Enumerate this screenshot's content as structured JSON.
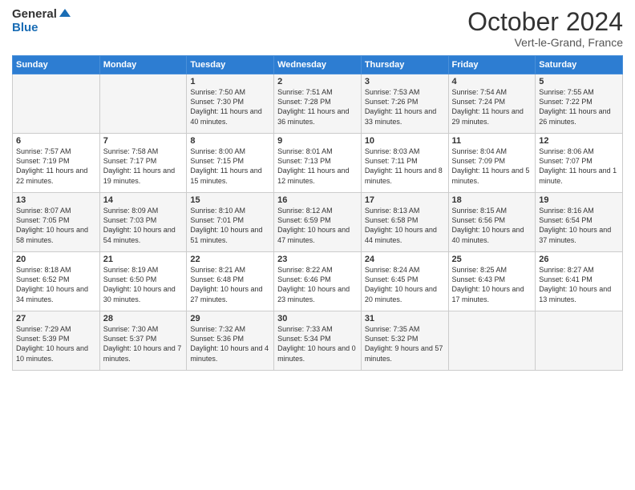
{
  "header": {
    "logo_line1": "General",
    "logo_line2": "Blue",
    "month_title": "October 2024",
    "subtitle": "Vert-le-Grand, France"
  },
  "weekdays": [
    "Sunday",
    "Monday",
    "Tuesday",
    "Wednesday",
    "Thursday",
    "Friday",
    "Saturday"
  ],
  "weeks": [
    [
      {
        "day": "",
        "sunrise": "",
        "sunset": "",
        "daylight": ""
      },
      {
        "day": "",
        "sunrise": "",
        "sunset": "",
        "daylight": ""
      },
      {
        "day": "1",
        "sunrise": "Sunrise: 7:50 AM",
        "sunset": "Sunset: 7:30 PM",
        "daylight": "Daylight: 11 hours and 40 minutes."
      },
      {
        "day": "2",
        "sunrise": "Sunrise: 7:51 AM",
        "sunset": "Sunset: 7:28 PM",
        "daylight": "Daylight: 11 hours and 36 minutes."
      },
      {
        "day": "3",
        "sunrise": "Sunrise: 7:53 AM",
        "sunset": "Sunset: 7:26 PM",
        "daylight": "Daylight: 11 hours and 33 minutes."
      },
      {
        "day": "4",
        "sunrise": "Sunrise: 7:54 AM",
        "sunset": "Sunset: 7:24 PM",
        "daylight": "Daylight: 11 hours and 29 minutes."
      },
      {
        "day": "5",
        "sunrise": "Sunrise: 7:55 AM",
        "sunset": "Sunset: 7:22 PM",
        "daylight": "Daylight: 11 hours and 26 minutes."
      }
    ],
    [
      {
        "day": "6",
        "sunrise": "Sunrise: 7:57 AM",
        "sunset": "Sunset: 7:19 PM",
        "daylight": "Daylight: 11 hours and 22 minutes."
      },
      {
        "day": "7",
        "sunrise": "Sunrise: 7:58 AM",
        "sunset": "Sunset: 7:17 PM",
        "daylight": "Daylight: 11 hours and 19 minutes."
      },
      {
        "day": "8",
        "sunrise": "Sunrise: 8:00 AM",
        "sunset": "Sunset: 7:15 PM",
        "daylight": "Daylight: 11 hours and 15 minutes."
      },
      {
        "day": "9",
        "sunrise": "Sunrise: 8:01 AM",
        "sunset": "Sunset: 7:13 PM",
        "daylight": "Daylight: 11 hours and 12 minutes."
      },
      {
        "day": "10",
        "sunrise": "Sunrise: 8:03 AM",
        "sunset": "Sunset: 7:11 PM",
        "daylight": "Daylight: 11 hours and 8 minutes."
      },
      {
        "day": "11",
        "sunrise": "Sunrise: 8:04 AM",
        "sunset": "Sunset: 7:09 PM",
        "daylight": "Daylight: 11 hours and 5 minutes."
      },
      {
        "day": "12",
        "sunrise": "Sunrise: 8:06 AM",
        "sunset": "Sunset: 7:07 PM",
        "daylight": "Daylight: 11 hours and 1 minute."
      }
    ],
    [
      {
        "day": "13",
        "sunrise": "Sunrise: 8:07 AM",
        "sunset": "Sunset: 7:05 PM",
        "daylight": "Daylight: 10 hours and 58 minutes."
      },
      {
        "day": "14",
        "sunrise": "Sunrise: 8:09 AM",
        "sunset": "Sunset: 7:03 PM",
        "daylight": "Daylight: 10 hours and 54 minutes."
      },
      {
        "day": "15",
        "sunrise": "Sunrise: 8:10 AM",
        "sunset": "Sunset: 7:01 PM",
        "daylight": "Daylight: 10 hours and 51 minutes."
      },
      {
        "day": "16",
        "sunrise": "Sunrise: 8:12 AM",
        "sunset": "Sunset: 6:59 PM",
        "daylight": "Daylight: 10 hours and 47 minutes."
      },
      {
        "day": "17",
        "sunrise": "Sunrise: 8:13 AM",
        "sunset": "Sunset: 6:58 PM",
        "daylight": "Daylight: 10 hours and 44 minutes."
      },
      {
        "day": "18",
        "sunrise": "Sunrise: 8:15 AM",
        "sunset": "Sunset: 6:56 PM",
        "daylight": "Daylight: 10 hours and 40 minutes."
      },
      {
        "day": "19",
        "sunrise": "Sunrise: 8:16 AM",
        "sunset": "Sunset: 6:54 PM",
        "daylight": "Daylight: 10 hours and 37 minutes."
      }
    ],
    [
      {
        "day": "20",
        "sunrise": "Sunrise: 8:18 AM",
        "sunset": "Sunset: 6:52 PM",
        "daylight": "Daylight: 10 hours and 34 minutes."
      },
      {
        "day": "21",
        "sunrise": "Sunrise: 8:19 AM",
        "sunset": "Sunset: 6:50 PM",
        "daylight": "Daylight: 10 hours and 30 minutes."
      },
      {
        "day": "22",
        "sunrise": "Sunrise: 8:21 AM",
        "sunset": "Sunset: 6:48 PM",
        "daylight": "Daylight: 10 hours and 27 minutes."
      },
      {
        "day": "23",
        "sunrise": "Sunrise: 8:22 AM",
        "sunset": "Sunset: 6:46 PM",
        "daylight": "Daylight: 10 hours and 23 minutes."
      },
      {
        "day": "24",
        "sunrise": "Sunrise: 8:24 AM",
        "sunset": "Sunset: 6:45 PM",
        "daylight": "Daylight: 10 hours and 20 minutes."
      },
      {
        "day": "25",
        "sunrise": "Sunrise: 8:25 AM",
        "sunset": "Sunset: 6:43 PM",
        "daylight": "Daylight: 10 hours and 17 minutes."
      },
      {
        "day": "26",
        "sunrise": "Sunrise: 8:27 AM",
        "sunset": "Sunset: 6:41 PM",
        "daylight": "Daylight: 10 hours and 13 minutes."
      }
    ],
    [
      {
        "day": "27",
        "sunrise": "Sunrise: 7:29 AM",
        "sunset": "Sunset: 5:39 PM",
        "daylight": "Daylight: 10 hours and 10 minutes."
      },
      {
        "day": "28",
        "sunrise": "Sunrise: 7:30 AM",
        "sunset": "Sunset: 5:37 PM",
        "daylight": "Daylight: 10 hours and 7 minutes."
      },
      {
        "day": "29",
        "sunrise": "Sunrise: 7:32 AM",
        "sunset": "Sunset: 5:36 PM",
        "daylight": "Daylight: 10 hours and 4 minutes."
      },
      {
        "day": "30",
        "sunrise": "Sunrise: 7:33 AM",
        "sunset": "Sunset: 5:34 PM",
        "daylight": "Daylight: 10 hours and 0 minutes."
      },
      {
        "day": "31",
        "sunrise": "Sunrise: 7:35 AM",
        "sunset": "Sunset: 5:32 PM",
        "daylight": "Daylight: 9 hours and 57 minutes."
      },
      {
        "day": "",
        "sunrise": "",
        "sunset": "",
        "daylight": ""
      },
      {
        "day": "",
        "sunrise": "",
        "sunset": "",
        "daylight": ""
      }
    ]
  ]
}
